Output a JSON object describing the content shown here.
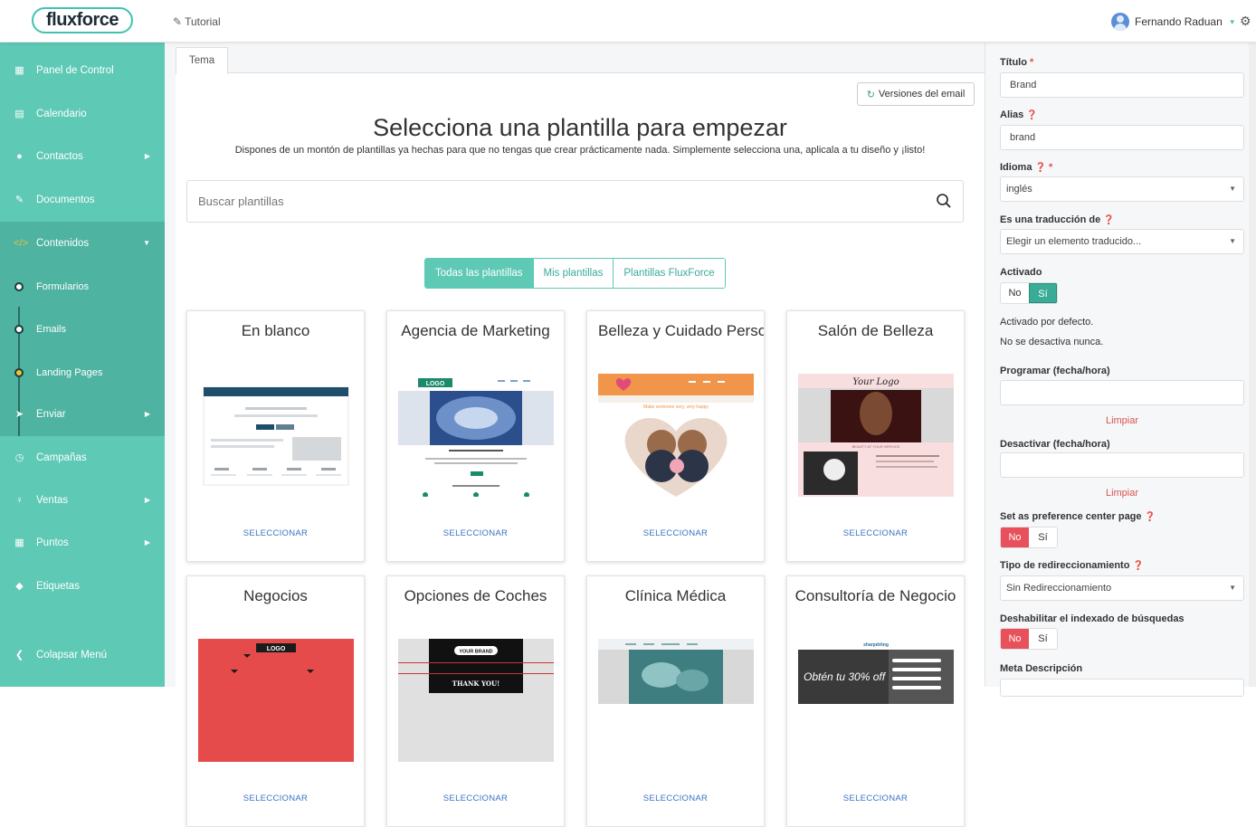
{
  "header": {
    "logo": "fluxforce",
    "tutorial": "Tutorial",
    "user_name": "Fernando Raduan"
  },
  "sidebar": {
    "items": [
      {
        "label": "Panel de Control",
        "icon": "dashboard-icon"
      },
      {
        "label": "Calendario",
        "icon": "calendar-icon"
      },
      {
        "label": "Contactos",
        "icon": "user-icon"
      },
      {
        "label": "Documentos",
        "icon": "paperclip-icon"
      },
      {
        "label": "Contenidos",
        "icon": "code-icon"
      },
      {
        "label": "Enviar",
        "icon": "paper-plane-icon"
      },
      {
        "label": "Campañas",
        "icon": "clock-icon"
      },
      {
        "label": "Ventas",
        "icon": "bulb-icon"
      },
      {
        "label": "Puntos",
        "icon": "calculator-icon"
      },
      {
        "label": "Etiquetas",
        "icon": "tag-icon"
      },
      {
        "label": "Colapsar Menú",
        "icon": "chevron-left-icon"
      }
    ],
    "subitems": [
      {
        "label": "Formularios"
      },
      {
        "label": "Emails"
      },
      {
        "label": "Landing Pages"
      }
    ]
  },
  "main": {
    "tab": "Tema",
    "versions_button": "Versiones del email",
    "title": "Selecciona una plantilla para empezar",
    "subtitle": "Dispones de un montón de plantillas ya hechas para que no tengas que crear prácticamente nada. Simplemente selecciona una, aplicala a tu diseño y ¡listo!",
    "search_placeholder": "Buscar plantillas",
    "filters": [
      "Todas las plantillas",
      "Mis plantillas",
      "Plantillas FluxForce"
    ],
    "select_label": "SELECCIONAR",
    "templates": [
      {
        "name": "En blanco"
      },
      {
        "name": "Agencia de Marketing",
        "logo_text": "LOGO"
      },
      {
        "name": "Belleza y Cuidado Personal",
        "banner_text": "Make someone very, very happy"
      },
      {
        "name": "Salón de Belleza",
        "logo_text": "Your Logo",
        "banner_text": "BEAUTY AT YOUR SERVICE"
      },
      {
        "name": "Negocios",
        "logo_text": "LOGO"
      },
      {
        "name": "Opciones de Coches",
        "logo_text": "YOUR BRAND",
        "banner_text": "THANK YOU!"
      },
      {
        "name": "Clínica Médica"
      },
      {
        "name": "Consultoría de Negocio",
        "logo_text": "sharpdrting",
        "banner_text": "Obtén tu 30% off"
      }
    ]
  },
  "form": {
    "titulo_label": "Título",
    "titulo_value": "Brand",
    "alias_label": "Alias",
    "alias_value": "brand",
    "idioma_label": "Idioma",
    "idioma_value": "inglés",
    "traduccion_label": "Es una traducción de",
    "traduccion_value": "Elegir un elemento traducido...",
    "activado_label": "Activado",
    "no": "No",
    "si": "Sí",
    "activado_note1": "Activado por defecto.",
    "activado_note2": "No se desactiva nunca.",
    "programar_label": "Programar (fecha/hora)",
    "limpiar": "Limpiar",
    "desactivar_label": "Desactivar (fecha/hora)",
    "preference_label": "Set as preference center page",
    "redirect_label": "Tipo de redireccionamiento",
    "redirect_value": "Sin Redireccionamiento",
    "indexado_label": "Deshabilitar el indexado de búsquedas",
    "meta_label": "Meta Descripción"
  }
}
